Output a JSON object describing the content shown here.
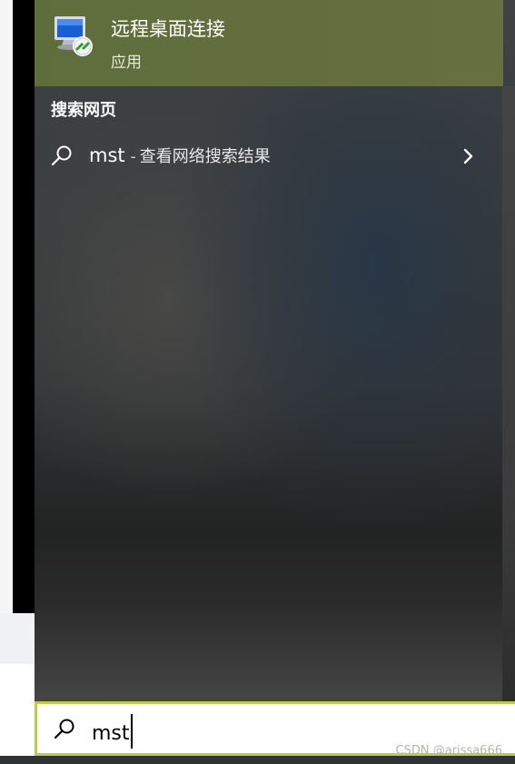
{
  "best_match": {
    "title": "远程桌面连接",
    "subtitle": "应用",
    "icon": "remote-desktop-icon",
    "highlight_color": "#636e3d"
  },
  "web_section": {
    "header": "搜索网页",
    "query": "mst",
    "separator": "-",
    "description": "查看网络搜索结果",
    "icon": "search-icon",
    "chevron": "chevron-right-icon"
  },
  "search_box": {
    "value": "mst",
    "icon": "search-icon",
    "border_color": "#bccc4a"
  },
  "watermark": "CSDN @arissa666"
}
